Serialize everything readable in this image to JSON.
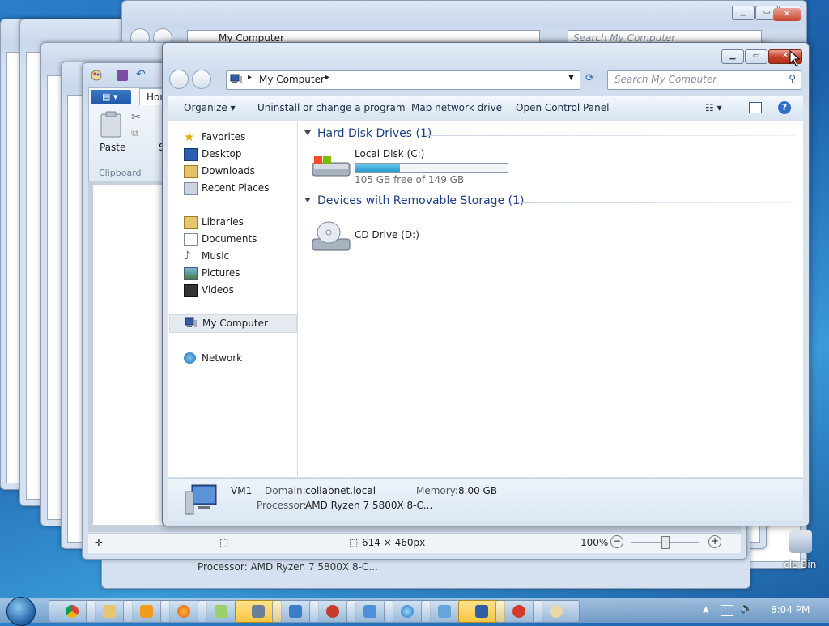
{
  "explorer": {
    "breadcrumb": "My Computer",
    "search_placeholder": "Search My Computer",
    "toolbar": {
      "organize": "Organize",
      "uninstall": "Uninstall or change a program",
      "map_drive": "Map network drive",
      "control_panel": "Open Control Panel"
    },
    "nav": {
      "favorites": "Favorites",
      "favorites_items": [
        "Desktop",
        "Downloads",
        "Recent Places"
      ],
      "libraries": "Libraries",
      "libraries_items": [
        "Documents",
        "Music",
        "Pictures",
        "Videos"
      ],
      "computer": "My Computer",
      "network": "Network"
    },
    "sections": {
      "hdd": "Hard Disk Drives (1)",
      "removable": "Devices with Removable Storage (1)"
    },
    "drives": {
      "c_name": "Local Disk (C:)",
      "c_free": "105 GB free of 149 GB",
      "c_used_fraction": 0.295,
      "d_name": "CD Drive (D:)"
    },
    "details": {
      "name": "VM1",
      "domain_label": "Domain:",
      "domain": "collabnet.local",
      "memory_label": "Memory:",
      "memory": "8.00 GB",
      "processor_label": "Processor:",
      "processor": "AMD Ryzen 7 5800X 8-C..."
    }
  },
  "background_windows": {
    "breadcrumb": "My Computer",
    "search_placeholder": "Search My Computer",
    "processor_text": "Processor: AMD Ryzen 7 5800X 8-C..."
  },
  "paint": {
    "tab_home": "Hon",
    "paste": "Paste",
    "clipboard": "Clipboard",
    "cut_letter": "S",
    "status_size": "614 × 460px",
    "zoom": "100%"
  },
  "desktop": {
    "recycle_bin": "cle Bin"
  },
  "taskbar": {
    "time": "8:04 PM"
  },
  "colors": {
    "accent": "#1e3d87",
    "progress_fill": "#2a9fd6",
    "close_red": "#c9452f"
  }
}
